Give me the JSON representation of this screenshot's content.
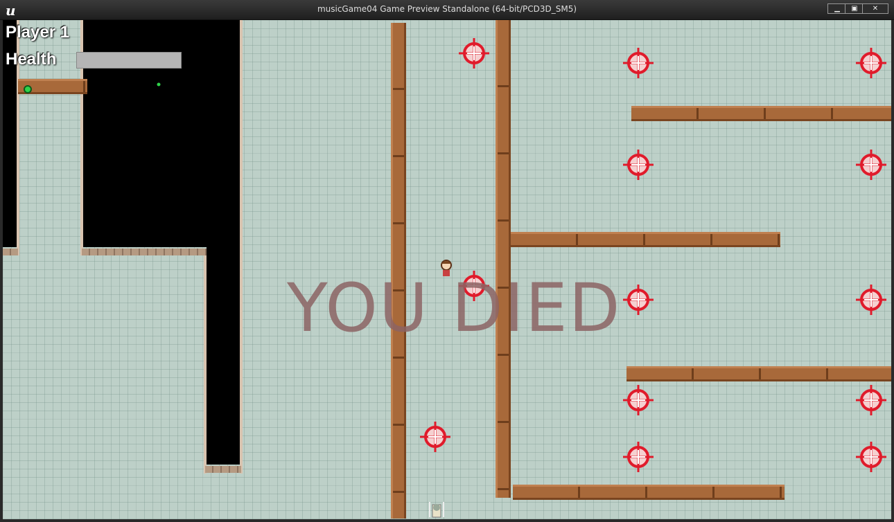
{
  "window": {
    "title": "musicGame04 Game Preview Standalone (64-bit/PCD3D_SM5)",
    "controls": [
      "minimize-icon",
      "maximize-icon",
      "close-icon"
    ]
  },
  "hud": {
    "player_label": "Player 1",
    "health_label": "Health",
    "health_fraction": 0
  },
  "overlay": {
    "message": "YOU DIED"
  },
  "colors": {
    "floor": "#bdd0c8",
    "plank": "#a8693a",
    "target": "#e01b2b",
    "void": "#000000",
    "overlay_text": "#8c6464"
  },
  "icons": [
    "unreal-engine-logo-icon",
    "crosshair-target-icon",
    "green-gem-icon",
    "player-character-icon"
  ]
}
